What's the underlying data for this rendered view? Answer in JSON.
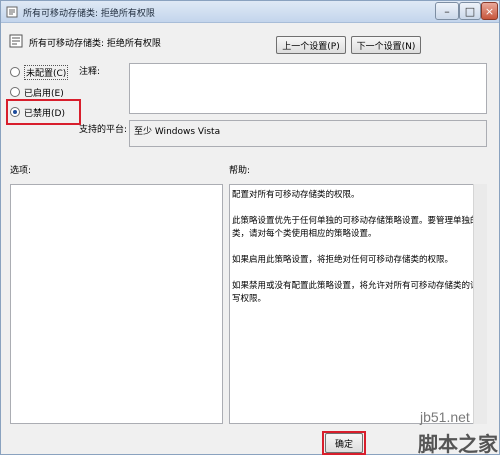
{
  "window": {
    "title": "所有可移动存储类: 拒绝所有权限"
  },
  "header": {
    "policy_name": "所有可移动存储类: 拒绝所有权限",
    "prev_label": "上一个设置(P)",
    "next_label": "下一个设置(N)"
  },
  "state": {
    "options": [
      {
        "label": "未配置(C)",
        "selected": false
      },
      {
        "label": "已启用(E)",
        "selected": false
      },
      {
        "label": "已禁用(D)",
        "selected": true
      }
    ]
  },
  "comment": {
    "label": "注释:",
    "value": ""
  },
  "platform": {
    "label": "支持的平台:",
    "value": "至少 Windows Vista"
  },
  "options_panel": {
    "label": "选项:"
  },
  "help_panel": {
    "label": "帮助:",
    "paragraphs": [
      "配置对所有可移动存储类的权限。",
      "此策略设置优先于任何单独的可移动存储策略设置。要管理单独的类，请对每个类使用相应的策略设置。",
      "如果启用此策略设置，将拒绝对任何可移动存储类的权限。",
      "如果禁用或没有配置此策略设置，将允许对所有可移动存储类的读写权限。"
    ]
  },
  "footer": {
    "ok_label": "确定"
  },
  "watermark": {
    "url": "jb51.net",
    "name": "脚本之家"
  },
  "colors": {
    "highlight": "#d81e2c",
    "titlebar": "#c3d5ec"
  }
}
